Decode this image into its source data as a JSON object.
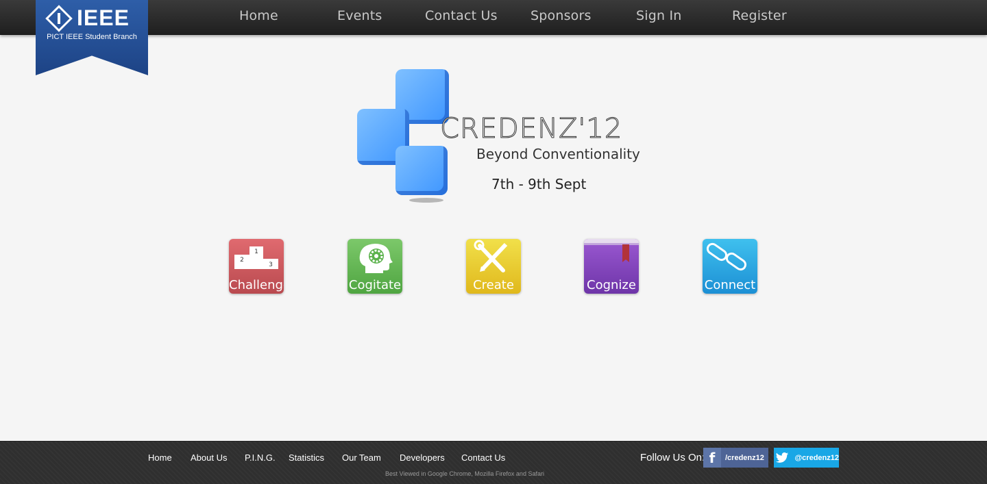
{
  "nav": {
    "items": [
      {
        "label": "Home"
      },
      {
        "label": "Events"
      },
      {
        "label": "Contact Us"
      },
      {
        "label": "Sponsors"
      },
      {
        "label": "Sign In"
      },
      {
        "label": "Register"
      }
    ]
  },
  "ribbon": {
    "logo_text": "IEEE",
    "subtitle": "PICT IEEE Student Branch"
  },
  "hero": {
    "title": "CREDENZ'12",
    "tagline": "Beyond Conventionality",
    "date": "7th - 9th Sept"
  },
  "tiles": [
    {
      "label": "Challenge",
      "color": "#c9545a"
    },
    {
      "label": "Cogitate",
      "color": "#5bb24c"
    },
    {
      "label": "Create",
      "color": "#e8c82c"
    },
    {
      "label": "Cognize",
      "color": "#7f42b8"
    },
    {
      "label": "Connect",
      "color": "#26a6e2"
    }
  ],
  "challenge_icon": {
    "pos1": "1",
    "pos2": "2",
    "pos3": "3"
  },
  "footer": {
    "links": [
      {
        "label": "Home"
      },
      {
        "label": "About Us"
      },
      {
        "label": "P.I.N.G."
      },
      {
        "label": "Statistics"
      },
      {
        "label": "Our Team"
      },
      {
        "label": "Developers"
      },
      {
        "label": "Contact Us"
      }
    ],
    "follow_label": "Follow Us On:",
    "facebook": {
      "icon": "facebook-icon",
      "label": "/credenz12"
    },
    "twitter": {
      "icon": "twitter-icon",
      "label": "@credenz12"
    },
    "note": "Best Viewed in Google Chrome, Mozilla Firefox and Safari"
  }
}
